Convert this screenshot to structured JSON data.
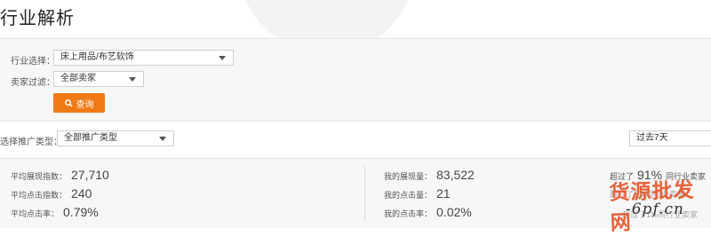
{
  "page": {
    "title": "行业解析"
  },
  "filters": {
    "industry": {
      "label": "行业选择：",
      "value": "床上用品/布艺软饰"
    },
    "seller": {
      "label": "卖家过滤：",
      "value": "全部卖家"
    },
    "query_button": {
      "label": "查询"
    }
  },
  "promo_type": {
    "label": "选择推广类型：",
    "value": "全部推广类型"
  },
  "period": {
    "value": "过去7天"
  },
  "stats": {
    "avg_impressions": {
      "label": "平均展现指数：",
      "value": "27,710"
    },
    "avg_clicks": {
      "label": "平均点击指数：",
      "value": "240"
    },
    "avg_ctr": {
      "label": "平均点击率：",
      "value": "0.79%"
    },
    "my_impressions": {
      "label": "我的展现量：",
      "value": "83,522"
    },
    "my_clicks": {
      "label": "我的点击量：",
      "value": "21"
    },
    "my_ctr": {
      "label": "我的点击率：",
      "value": "0.02%"
    }
  },
  "comparison": {
    "line1_prefix": "超过了",
    "line1_value": "91%",
    "line1_suffix": "同行业卖家",
    "line2": "超过了5%同行业卖家",
    "line3": "超过了1%同行业卖家"
  },
  "watermark": {
    "main": "货源批发网",
    "sub": "-6pf.cn"
  }
}
